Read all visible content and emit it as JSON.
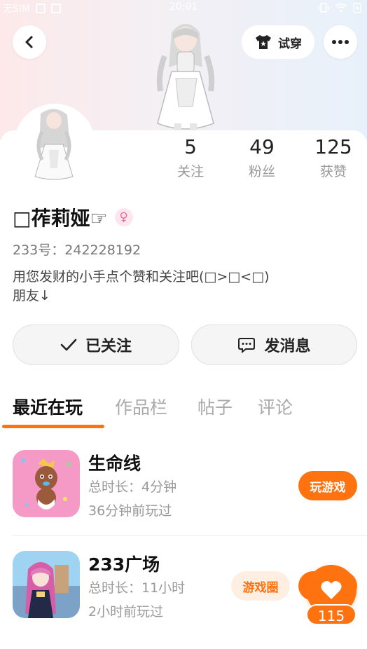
{
  "status_bar": {
    "carrier": "无SIM",
    "time": "20:01"
  },
  "header": {
    "tryon_label": "试穿"
  },
  "profile": {
    "stats": [
      {
        "value": "5",
        "label": "关注"
      },
      {
        "value": "49",
        "label": "粉丝"
      },
      {
        "value": "125",
        "label": "获赞"
      }
    ],
    "name": "□莋莉娅☞",
    "gender_symbol": "♀",
    "uid": "233号：242228192",
    "bio": "用您发财的小手点个赞和关注吧(□>□<□)\n朋友↓"
  },
  "actions": {
    "follow_label": "已关注",
    "message_label": "发消息"
  },
  "tabs": [
    {
      "label": "最近在玩",
      "active": true
    },
    {
      "label": "作品栏",
      "active": false
    },
    {
      "label": "帖子",
      "active": false
    },
    {
      "label": "评论",
      "active": false
    }
  ],
  "games": [
    {
      "name": "生命线",
      "duration": "总时长：4分钟",
      "last_played": "36分钟前玩过",
      "play_label": "玩游戏"
    },
    {
      "name": "233广场",
      "duration": "总时长：11小时",
      "last_played": "2小时前玩过",
      "circle_label": "游戏圈"
    }
  ],
  "like": {
    "count": "115"
  },
  "colors": {
    "accent": "#ff7210",
    "accent_light": "#ffeee2",
    "gender_pink": "#f06a9b",
    "text_secondary": "#999999"
  }
}
